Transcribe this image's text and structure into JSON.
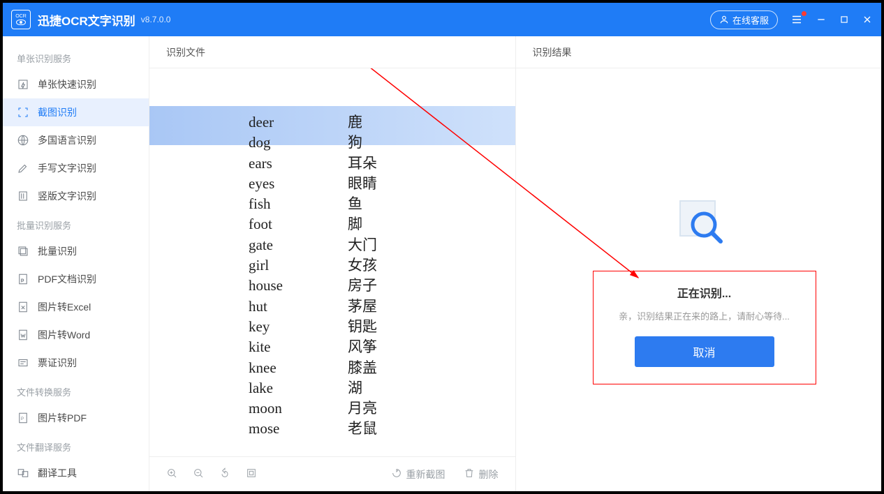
{
  "app": {
    "title": "迅捷OCR文字识别",
    "version": "v8.7.0.0"
  },
  "titlebar": {
    "support": "在线客服"
  },
  "sidebar": {
    "groups": [
      {
        "header": "单张识别服务",
        "items": [
          {
            "id": "single-quick",
            "label": "单张快速识别"
          },
          {
            "id": "screenshot",
            "label": "截图识别",
            "active": true
          },
          {
            "id": "multilang",
            "label": "多国语言识别"
          },
          {
            "id": "handwriting",
            "label": "手写文字识别"
          },
          {
            "id": "vertical",
            "label": "竖版文字识别"
          }
        ]
      },
      {
        "header": "批量识别服务",
        "items": [
          {
            "id": "batch",
            "label": "批量识别"
          },
          {
            "id": "pdf-doc",
            "label": "PDF文档识别"
          },
          {
            "id": "img-excel",
            "label": "图片转Excel"
          },
          {
            "id": "img-word",
            "label": "图片转Word"
          },
          {
            "id": "ticket",
            "label": "票证识别"
          }
        ]
      },
      {
        "header": "文件转换服务",
        "items": [
          {
            "id": "img-pdf",
            "label": "图片转PDF"
          }
        ]
      },
      {
        "header": "文件翻译服务",
        "items": [
          {
            "id": "translate",
            "label": "翻译工具"
          }
        ]
      }
    ]
  },
  "content": {
    "file_header": "识别文件",
    "result_header": "识别结果"
  },
  "words": [
    {
      "en": "deer",
      "zh": "鹿"
    },
    {
      "en": "dog",
      "zh": "狗"
    },
    {
      "en": "ears",
      "zh": "耳朵"
    },
    {
      "en": "eyes",
      "zh": "眼睛"
    },
    {
      "en": "fish",
      "zh": "鱼"
    },
    {
      "en": "foot",
      "zh": "脚"
    },
    {
      "en": "gate",
      "zh": "大门"
    },
    {
      "en": "girl",
      "zh": "女孩"
    },
    {
      "en": "house",
      "zh": "房子"
    },
    {
      "en": "hut",
      "zh": "茅屋"
    },
    {
      "en": "key",
      "zh": "钥匙"
    },
    {
      "en": "kite",
      "zh": "风筝"
    },
    {
      "en": "knee",
      "zh": "膝盖"
    },
    {
      "en": "lake",
      "zh": "湖"
    },
    {
      "en": "moon",
      "zh": "月亮"
    },
    {
      "en": "mose",
      "zh": "老鼠"
    }
  ],
  "progress": {
    "title": "正在识别...",
    "subtitle": "亲，识别结果正在来的路上，请耐心等待...",
    "cancel": "取消"
  },
  "bottom": {
    "recapture": "重新截图",
    "delete": "删除"
  }
}
